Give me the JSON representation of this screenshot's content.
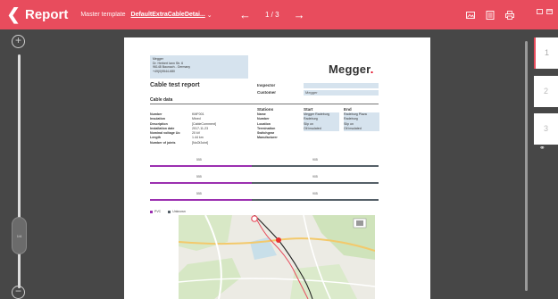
{
  "header": {
    "back_icon": "chevron-left-icon",
    "title": "Report",
    "template_label": "Master template",
    "template_value": "DefaultExtraCableDetai...",
    "page_indicator": "1 / 3",
    "prev_icon": "arrow-left-icon",
    "next_icon": "arrow-right-icon",
    "tools": [
      "image-icon",
      "table-icon",
      "print-icon"
    ],
    "accent_color": "#e84c5d"
  },
  "zoom": {
    "in_icon": "zoom-in-icon",
    "out_icon": "zoom-out-icon",
    "level": "1/4"
  },
  "document": {
    "address": [
      "Megger",
      "Dr. Herbert Iann Str. 6",
      "96148 Baunach - Germany",
      "+49(0)9544-680"
    ],
    "logo": "Megger",
    "title": "Cable test report",
    "inspector_label": "Inspector",
    "inspector_value": "",
    "customer_label": "Customer",
    "customer_value": "Megger",
    "section": "Cable data",
    "cable_labels": [
      "Number",
      "Insulation",
      "Description",
      "Installation date",
      "Nominal voltage Uo",
      "Length",
      "Number of joints"
    ],
    "cable_values": [
      "KMF001",
      "Mixed",
      "[CableComment]",
      "2017-11-23",
      "20 kV",
      "1.44 km",
      "[NoOfJoint]"
    ],
    "stations_header": "Stations",
    "start_header": "Start",
    "end_header": "End",
    "station_labels": [
      "Name",
      "Number",
      "Location",
      "Termination",
      "Switchgear",
      "Manufacturer"
    ],
    "start_values": [
      "Megger Radeburg",
      "",
      "Radeburg",
      "Slip on",
      "Oil insulated",
      ""
    ],
    "end_values": [
      "Radeburg Plaza",
      "",
      "Radeburg",
      "Slip on",
      "Oil insulated",
      ""
    ],
    "bar_labels": [
      [
        "555",
        "905"
      ],
      [
        "555",
        "905"
      ],
      [
        "555",
        "905"
      ]
    ],
    "legend": [
      {
        "label": "PVC",
        "color": "#9b2fb0"
      },
      {
        "label": "Unknown",
        "color": "#556068"
      }
    ]
  },
  "pages": {
    "items": [
      "1",
      "2",
      "3"
    ],
    "active": "1",
    "link_icon": "link-icon"
  }
}
